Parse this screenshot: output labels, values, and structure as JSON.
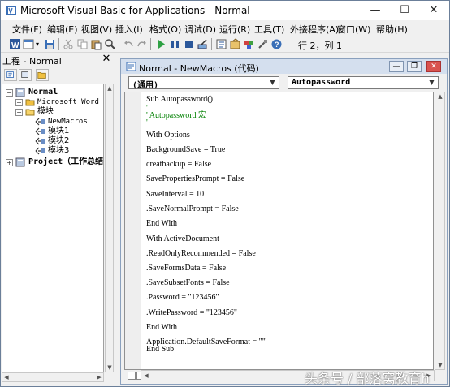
{
  "window": {
    "title": "Microsoft Visual Basic for Applications - Normal",
    "minimize": "—",
    "maximize": "☐",
    "close": "✕"
  },
  "menu": [
    "文件(F)",
    "编辑(E)",
    "视图(V)",
    "插入(I)",
    "格式(O)",
    "调试(D)",
    "运行(R)",
    "工具(T)",
    "外接程序(A)",
    "窗口(W)",
    "帮助(H)"
  ],
  "toolbar": {
    "position_status": "行 2，列 1"
  },
  "project_pane": {
    "title": "工程 - Normal",
    "close": "✕",
    "tree": {
      "normal": "Normal",
      "word_objects": "Microsoft Word 对象",
      "modules_folder": "模块",
      "modules": [
        "NewMacros",
        "模块1",
        "模块2",
        "模块3"
      ],
      "other_project": "Project（工作总结和"
    }
  },
  "code_window": {
    "title": "Normal - NewMacros (代码)",
    "object_dropdown": "(通用)",
    "procedure_dropdown": "Autopassword",
    "lines": [
      "Sub Autopassword()",
      "'",
      "' Autopassword 宏",
      "'",
      "With Options",
      "BackgroundSave = True",
      "creatbackup = False",
      "SavePropertiesPrompt = False",
      "SaveInterval = 10",
      ".SaveNormalPrompt = False",
      "End With",
      "With ActiveDocument",
      ".ReadOnlyRecommended = False",
      ".SaveFormsData = False",
      ".SaveSubsetFonts = False",
      ".Password = \"123456\"",
      ".WritePassword = \"123456\"",
      "End With",
      "Application.DefaultSaveFormat = \"\"",
      "End Sub"
    ]
  },
  "watermark": "头条号 / 部落窝教育h"
}
